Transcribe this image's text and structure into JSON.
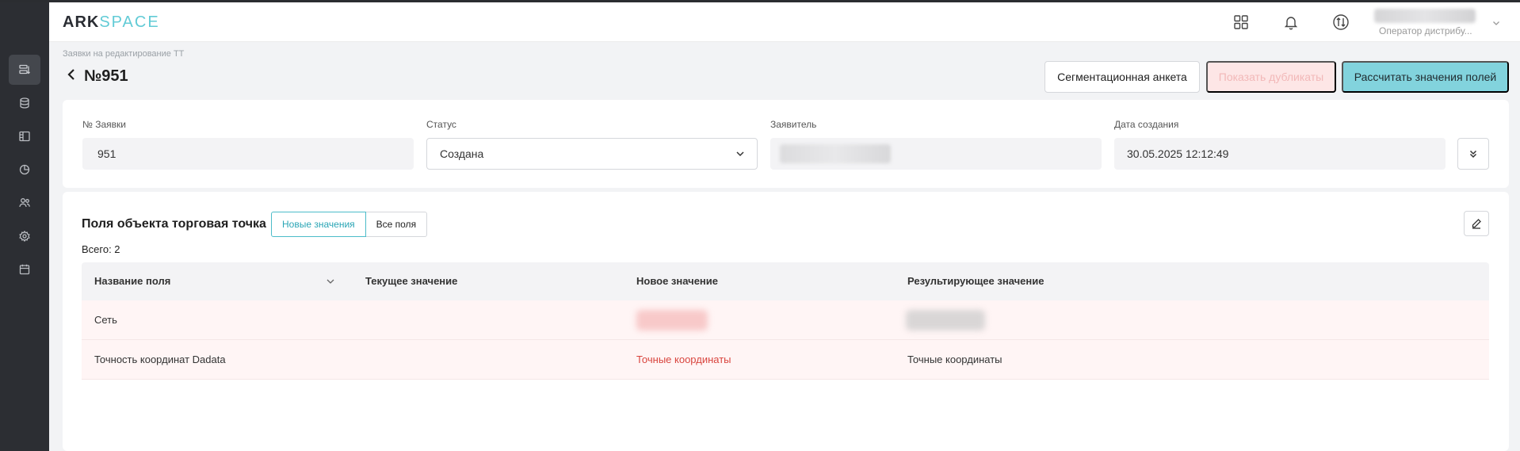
{
  "header": {
    "logo_primary": "ARK",
    "logo_secondary": "SPACE",
    "user_role": "Оператор дистрибу..."
  },
  "page": {
    "breadcrumb": "Заявки на редактирование ТТ",
    "title": "№951"
  },
  "actions": {
    "segment_form": "Сегментационная анкета",
    "show_duplicates": "Показать дубликаты",
    "calculate": "Рассчитать значения полей"
  },
  "request_info": {
    "number_label": "№ Заявки",
    "number_value": "951",
    "status_label": "Статус",
    "status_value": "Создана",
    "applicant_label": "Заявитель",
    "created_label": "Дата создания",
    "created_value": "30.05.2025 12:12:49"
  },
  "fields_section": {
    "title": "Поля объекта торговая точка",
    "tabs": [
      "Новые значения",
      "Все поля"
    ],
    "active_tab": "Новые значения",
    "total": "Всего: 2",
    "columns": [
      "Название поля",
      "Текущее значение",
      "Новое значение",
      "Результирующее значение"
    ],
    "rows": [
      {
        "name": "Сеть",
        "current": "",
        "new": "",
        "result": ""
      },
      {
        "name": "Точность координат Dadata",
        "current": "",
        "new": "Точные координаты",
        "result": "Точные координаты"
      }
    ]
  },
  "colors": {
    "accent": "#4cbcc9",
    "sidebar": "#2c2e33",
    "danger_text": "#d9453e",
    "row_highlight": "#fff5f5"
  }
}
